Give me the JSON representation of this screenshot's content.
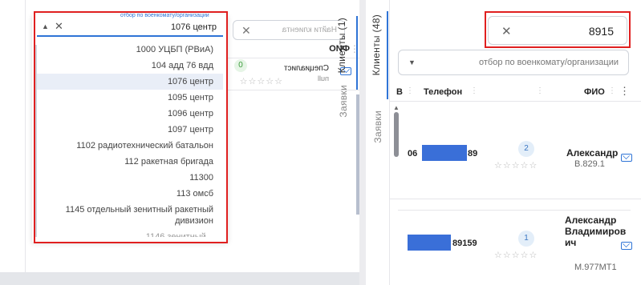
{
  "left_panel": {
    "tabs": {
      "clients": "Клиенты (1)",
      "requests": "Заявки"
    },
    "search_placeholder": "Найти клиента",
    "filter_hint": "отбор по военкомату/организации",
    "filter_value": "1076 центр",
    "columns": {
      "fio": "ФИО",
      "phone": "Телефон"
    },
    "client": {
      "name": "Специалист",
      "sub": "null",
      "badge": "0"
    },
    "options": [
      "1000 УЦБП (РВиА)",
      "104 адд 76 вдд",
      "1076 центр",
      "1095 центр",
      "1096 центр",
      "1097 центр",
      "1102 радиотехнический батальон",
      "112 ракетная бригада",
      "11300",
      "113 омсб",
      "1145 отдельный зенитный ракетный",
      "дивизион",
      "1146 зенитный..."
    ],
    "selected_index": 2
  },
  "right_panel": {
    "tabs": {
      "clients": "Клиенты (48)",
      "requests": "Заявки"
    },
    "search_value": "8915",
    "filter_placeholder": "отбор по военкомату/организации",
    "columns": {
      "fio": "ФИО",
      "phone": "Телефон",
      "extra": "В"
    },
    "clients": [
      {
        "name": "Александр",
        "sub": "В.829.1",
        "badge": "2",
        "phone_prefix": "89",
        "phone_suffix": "06"
      },
      {
        "name": "Александр Владимиров ич",
        "sub": "М.977МТ1",
        "badge": "1",
        "phone_prefix": "89159",
        "phone_suffix": ""
      }
    ]
  },
  "icons": [
    "close-icon",
    "chevron-up-icon",
    "chevron-down-icon",
    "mail-icon",
    "more-icon",
    "star-icon"
  ],
  "colors": {
    "accent": "#2f74d6",
    "highlight": "#e02020",
    "redaction": "#3a6fd8"
  }
}
